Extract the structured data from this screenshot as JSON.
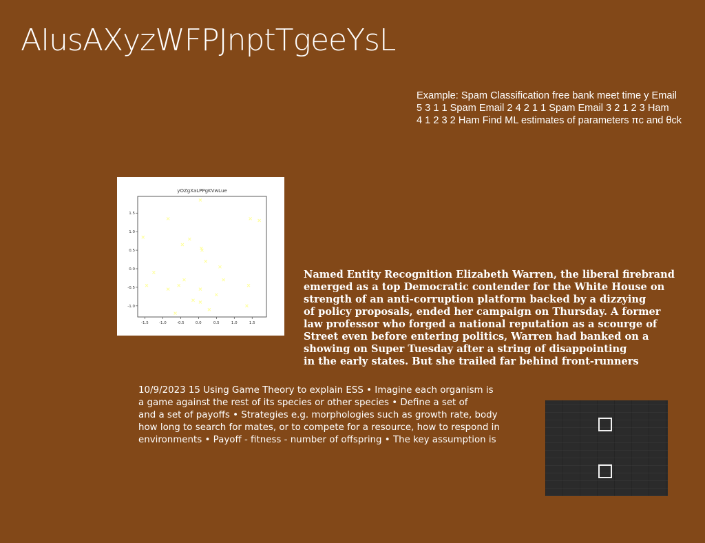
{
  "title": "AIusAXyzWFPJnptTgeeYsL",
  "spam_text": [
    "Example: Spam Classification free bank meet time y Email",
    "5 3 1 1 Spam Email 2 4 2 1 1 Spam Email 3 2 1 2 3 Ham",
    "4 1 2 3 2 Ham Find ML estimates of parameters πc and θck"
  ],
  "ner_text": [
    "Named Entity Recognition Elizabeth Warren, the liberal firebrand",
    "emerged as a top Democratic contender for the White House on",
    "strength of an anti-corruption platform backed by a dizzying",
    "of policy proposals, ended her campaign on Thursday. A former",
    "law professor who forged a national reputation as a scourge of",
    "Street even before entering politics, Warren had banked on a",
    "showing on Super Tuesday after a string of disappointing",
    "in the early states. But she trailed far behind front-runners"
  ],
  "ess_text": [
    "10/9/2023 15 Using Game Theory to explain ESS • Imagine each organism is",
    "a game against the rest of its species or other species • Define a set of",
    "and a set of payoffs • Strategies e.g. morphologies such as growth rate, body",
    "how long to search for mates, or to compete for a resource, how to respond in",
    "environments • Payoff - fitness - number of offspring • The key assumption is"
  ],
  "chart_data": {
    "type": "scatter",
    "title": "yOZgXaLPPgKVwLue",
    "xlabel": "",
    "ylabel": "",
    "xlim": [
      -1.7,
      1.9
    ],
    "ylim": [
      -1.3,
      1.95
    ],
    "xticks": [
      "-1.5",
      "-1.0",
      "-0.5",
      "0.0",
      "0.5",
      "1.0",
      "1.5"
    ],
    "yticks": [
      "1.5",
      "1.0",
      "0.5",
      "0.0",
      "-0.5",
      "-1.0"
    ],
    "grid": false,
    "marker_color": "#ffff99",
    "x": [
      0.05,
      -0.85,
      -1.55,
      -0.25,
      0.08,
      -0.45,
      0.1,
      1.45,
      1.7,
      -1.25,
      0.2,
      0.6,
      -1.45,
      -0.55,
      -0.85,
      -0.4,
      0.7,
      0.05,
      1.4,
      -0.15,
      0.05,
      0.5,
      1.35,
      0.3,
      -0.65
    ],
    "y": [
      1.85,
      1.35,
      0.85,
      0.8,
      0.55,
      0.65,
      0.5,
      1.35,
      1.3,
      -0.1,
      0.2,
      0.05,
      -0.45,
      -0.45,
      -0.55,
      -0.3,
      -0.3,
      -0.55,
      -0.45,
      -0.85,
      -0.9,
      -0.7,
      -1.0,
      -1.1,
      -1.2
    ]
  },
  "panel": {
    "checkbox_1": "unchecked",
    "checkbox_2": "unchecked"
  }
}
